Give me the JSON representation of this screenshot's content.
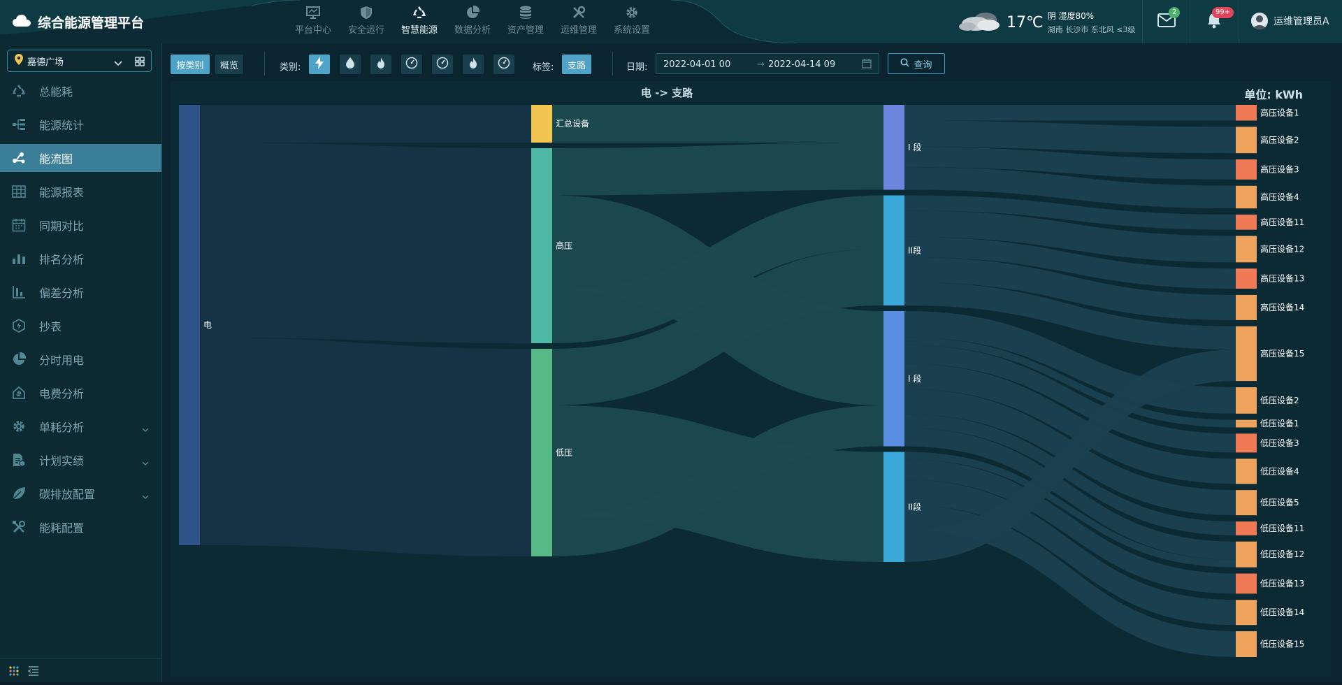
{
  "app": {
    "title": "综合能源管理平台"
  },
  "topnav": [
    {
      "label": "平台中心",
      "icon": "monitor-icon",
      "active": false
    },
    {
      "label": "安全运行",
      "icon": "shield-icon",
      "active": false
    },
    {
      "label": "智慧能源",
      "icon": "recycle-icon",
      "active": true
    },
    {
      "label": "数据分析",
      "icon": "pie-chart-icon",
      "active": false
    },
    {
      "label": "资产管理",
      "icon": "database-icon",
      "active": false
    },
    {
      "label": "运维管理",
      "icon": "tools-icon",
      "active": false
    },
    {
      "label": "系统设置",
      "icon": "gear-icon",
      "active": false
    }
  ],
  "weather": {
    "temp": "17℃",
    "line1": "阴 湿度80%",
    "line2": "湖南 长沙市 东北风 ≤3级"
  },
  "header": {
    "mail_badge": "2",
    "bell_badge": "99+",
    "user": "运维管理员A"
  },
  "sidebar": {
    "site": "嘉德广场",
    "items": [
      {
        "label": "总能耗",
        "icon": "recycle-icon",
        "active": false,
        "chevron": false
      },
      {
        "label": "能源统计",
        "icon": "tree-icon",
        "active": false,
        "chevron": false
      },
      {
        "label": "能流图",
        "icon": "flow-icon",
        "active": true,
        "chevron": false
      },
      {
        "label": "能源报表",
        "icon": "table-icon",
        "active": false,
        "chevron": false
      },
      {
        "label": "同期对比",
        "icon": "calendar-icon",
        "active": false,
        "chevron": false
      },
      {
        "label": "排名分析",
        "icon": "bar-icon",
        "active": false,
        "chevron": false
      },
      {
        "label": "偏差分析",
        "icon": "deviation-icon",
        "active": false,
        "chevron": false
      },
      {
        "label": "抄表",
        "icon": "meter-icon",
        "active": false,
        "chevron": false
      },
      {
        "label": "分时用电",
        "icon": "pie-icon",
        "active": false,
        "chevron": false
      },
      {
        "label": "电费分析",
        "icon": "house-icon",
        "active": false,
        "chevron": false
      },
      {
        "label": "单耗分析",
        "icon": "gear-icon",
        "active": false,
        "chevron": true
      },
      {
        "label": "计划实绩",
        "icon": "doc-icon",
        "active": false,
        "chevron": true
      },
      {
        "label": "碳排放配置",
        "icon": "leaf-icon",
        "active": false,
        "chevron": true
      },
      {
        "label": "能耗配置",
        "icon": "wrench-icon",
        "active": false,
        "chevron": false
      }
    ]
  },
  "toolbar": {
    "by_category": "按类别",
    "overview": "概览",
    "category_label": "类别:",
    "tag_label": "标签:",
    "tag_value": "支路",
    "date_label": "日期:",
    "date_start": "2022-04-01 00",
    "date_arrow": "→",
    "date_end": "2022-04-14 09",
    "query": "查询"
  },
  "chart_data": {
    "type": "sankey",
    "title": "电 -> 支路",
    "unit": "单位: kWh",
    "nodes": [
      {
        "name": "电",
        "label": "电",
        "level": 0
      },
      {
        "name": "汇总设备",
        "label": "汇总设备",
        "level": 1
      },
      {
        "name": "高压",
        "label": "高压",
        "level": 1
      },
      {
        "name": "低压",
        "label": "低压",
        "level": 1
      },
      {
        "name": "高压-I段",
        "label": "I 段",
        "level": 2
      },
      {
        "name": "高压-II段",
        "label": "II段",
        "level": 2
      },
      {
        "name": "低压-I段",
        "label": "I 段",
        "level": 2
      },
      {
        "name": "低压-II段",
        "label": "II段",
        "level": 2
      },
      {
        "name": "高压设备1",
        "label": "高压设备1",
        "level": 3
      },
      {
        "name": "高压设备2",
        "label": "高压设备2",
        "level": 3
      },
      {
        "name": "高压设备3",
        "label": "高压设备3",
        "level": 3
      },
      {
        "name": "高压设备4",
        "label": "高压设备4",
        "level": 3
      },
      {
        "name": "高压设备11",
        "label": "高压设备11",
        "level": 3
      },
      {
        "name": "高压设备12",
        "label": "高压设备12",
        "level": 3
      },
      {
        "name": "高压设备13",
        "label": "高压设备13",
        "level": 3
      },
      {
        "name": "高压设备14",
        "label": "高压设备14",
        "level": 3
      },
      {
        "name": "高压设备15",
        "label": "高压设备15",
        "level": 3
      },
      {
        "name": "低压设备2",
        "label": "低压设备2",
        "level": 3
      },
      {
        "name": "低压设备1",
        "label": "低压设备1",
        "level": 3
      },
      {
        "name": "低压设备3",
        "label": "低压设备3",
        "level": 3
      },
      {
        "name": "低压设备4",
        "label": "低压设备4",
        "level": 3
      },
      {
        "name": "低压设备5",
        "label": "低压设备5",
        "level": 3
      },
      {
        "name": "低压设备11",
        "label": "低压设备11",
        "level": 3
      },
      {
        "name": "低压设备12",
        "label": "低压设备12",
        "level": 3
      },
      {
        "name": "低压设备13",
        "label": "低压设备13",
        "level": 3
      },
      {
        "name": "低压设备14",
        "label": "低压设备14",
        "level": 3
      },
      {
        "name": "低压设备15",
        "label": "低压设备15",
        "level": 3
      }
    ],
    "links": [
      {
        "source": "电",
        "target": "汇总设备",
        "value": 60
      },
      {
        "source": "电",
        "target": "高压",
        "value": 310
      },
      {
        "source": "电",
        "target": "低压",
        "value": 330
      },
      {
        "source": "汇总设备",
        "target": "高压-I段",
        "value": 60
      },
      {
        "source": "高压",
        "target": "高压-I段",
        "value": 75
      },
      {
        "source": "高压",
        "target": "低压-I段",
        "value": 150
      },
      {
        "source": "高压",
        "target": "高压-II段",
        "value": 85
      },
      {
        "source": "低压",
        "target": "高压-II段",
        "value": 90
      },
      {
        "source": "低压",
        "target": "低压-II段",
        "value": 175
      },
      {
        "source": "低压",
        "target": "低压-I段",
        "value": 65
      },
      {
        "source": "高压-I段",
        "target": "高压设备1",
        "value": 25
      },
      {
        "source": "高压-I段",
        "target": "高压设备2",
        "value": 42
      },
      {
        "source": "高压-I段",
        "target": "高压设备3",
        "value": 32
      },
      {
        "source": "高压-I段",
        "target": "高压设备4",
        "value": 36
      },
      {
        "source": "高压-II段",
        "target": "高压设备11",
        "value": 24
      },
      {
        "source": "高压-II段",
        "target": "高压设备12",
        "value": 42
      },
      {
        "source": "高压-II段",
        "target": "高压设备13",
        "value": 32
      },
      {
        "source": "高压-II段",
        "target": "高压设备14",
        "value": 40
      },
      {
        "source": "高压-II段",
        "target": "高压设备15",
        "value": 37
      },
      {
        "source": "低压-I段",
        "target": "低压设备2",
        "value": 42
      },
      {
        "source": "低压-I段",
        "target": "低压设备1",
        "value": 12
      },
      {
        "source": "低压-I段",
        "target": "低压设备3",
        "value": 30
      },
      {
        "source": "低压-I段",
        "target": "低压设备4",
        "value": 40
      },
      {
        "source": "低压-I段",
        "target": "低压设备5",
        "value": 40
      },
      {
        "source": "低压-I段",
        "target": "低压设备11",
        "value": 22
      },
      {
        "source": "低压-I段",
        "target": "低压设备12",
        "value": 29
      },
      {
        "source": "低压-II段",
        "target": "低压设备12",
        "value": 12
      },
      {
        "source": "低压-II段",
        "target": "低压设备13",
        "value": 32
      },
      {
        "source": "低压-II段",
        "target": "低压设备14",
        "value": 40
      },
      {
        "source": "低压-II段",
        "target": "低压设备15",
        "value": 41
      },
      {
        "source": "低压-II段",
        "target": "高压设备15",
        "value": 50
      }
    ],
    "colors": {
      "电": "#2f5289",
      "汇总设备": "#f2c552",
      "高压": "#4fb8a4",
      "低压": "#58b988",
      "高压-I段": "#6b86dc",
      "高压-II段": "#3aa8d8",
      "低压-I段": "#5a8ee0",
      "低压-II段": "#3aa8d8",
      "device": "#f0a35c",
      "device_alt": "#f07a55"
    }
  }
}
